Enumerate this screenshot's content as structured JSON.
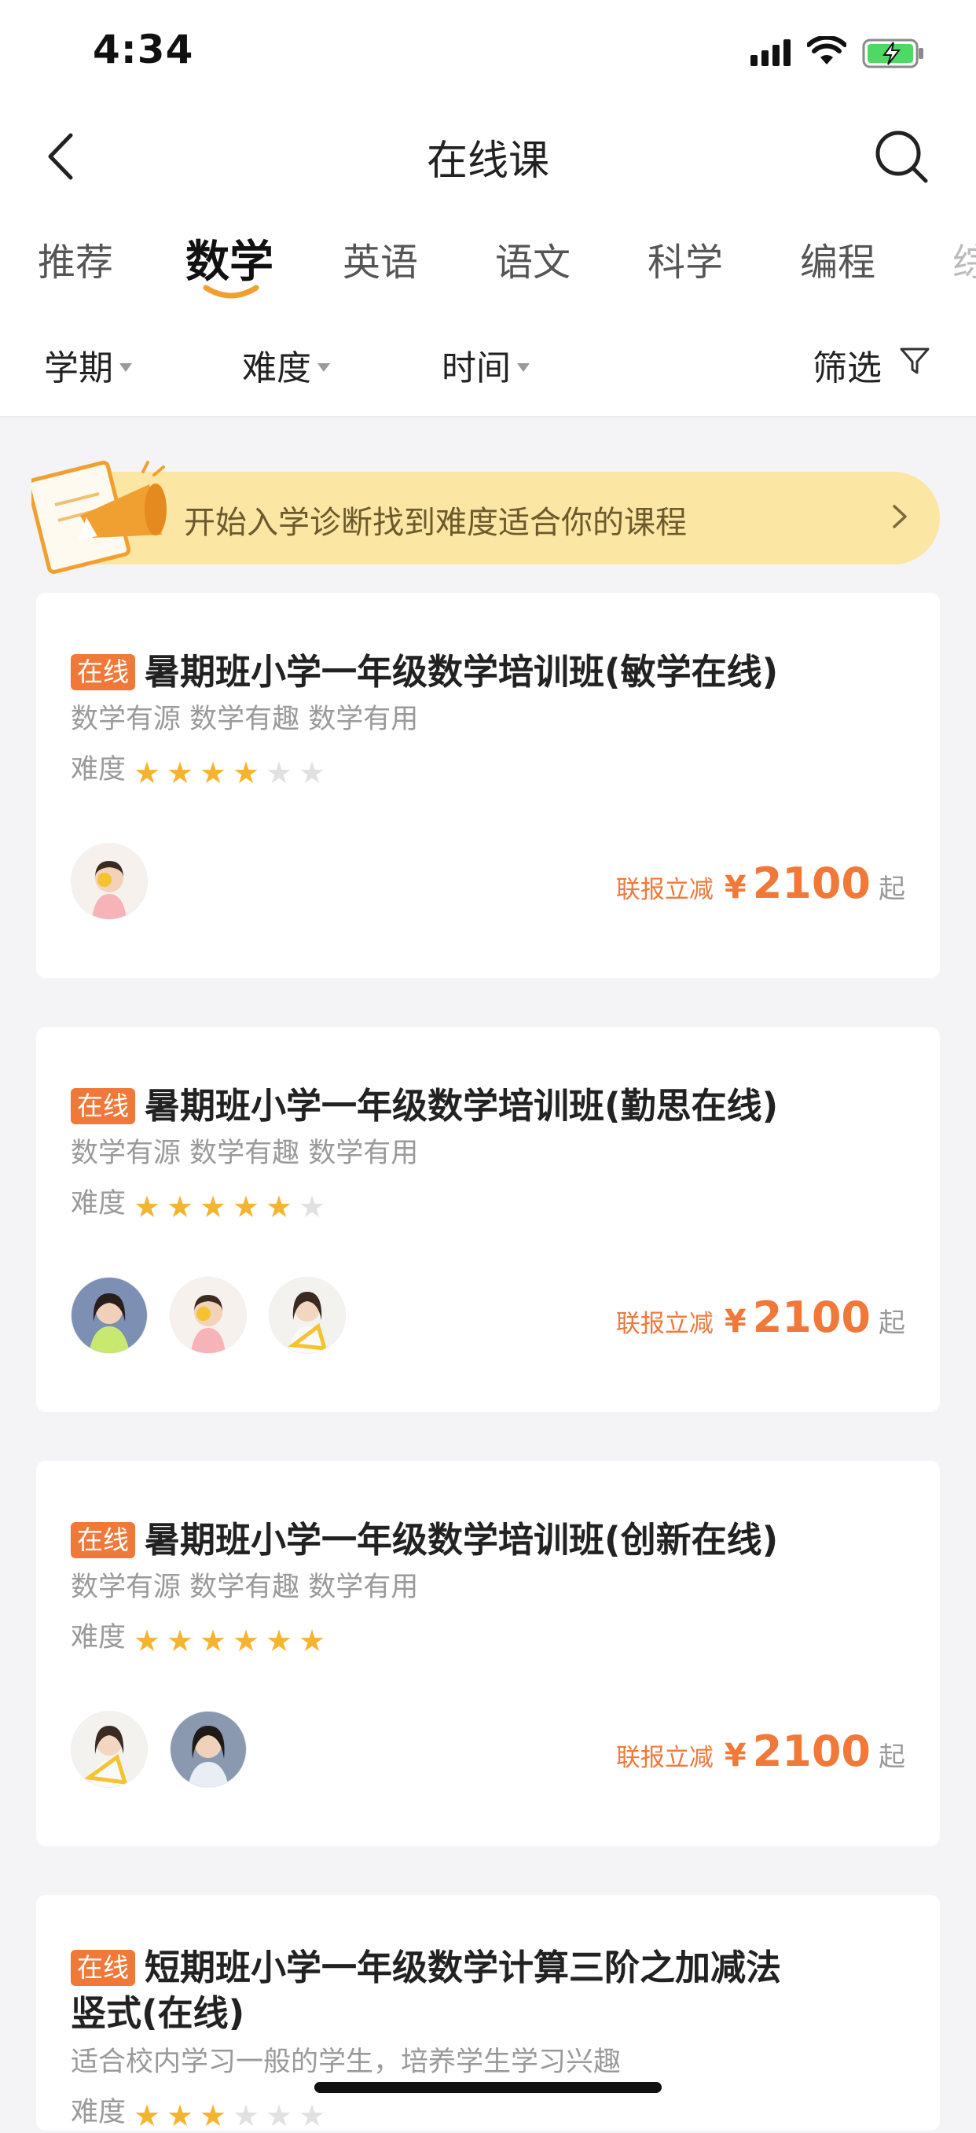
{
  "status": {
    "time": "4:34",
    "signal_icon": "cellular-signal-icon",
    "wifi_icon": "wifi-icon",
    "battery_icon": "battery-charging-icon"
  },
  "nav": {
    "title": "在线课",
    "back_icon": "chevron-left-icon",
    "search_icon": "search-icon"
  },
  "tabs": [
    {
      "label": "推荐"
    },
    {
      "label": "数学",
      "active": true
    },
    {
      "label": "英语"
    },
    {
      "label": "语文"
    },
    {
      "label": "科学"
    },
    {
      "label": "编程"
    },
    {
      "label": "综"
    }
  ],
  "filters": {
    "term": "学期",
    "difficulty": "难度",
    "time": "时间",
    "filter": "筛选",
    "filter_icon": "funnel-icon"
  },
  "banner": {
    "text": "开始入学诊断找到难度适合你的课程",
    "icon": "megaphone-icon",
    "arrow_icon": "chevron-right-icon"
  },
  "courses": [
    {
      "badge": "在线",
      "title": "暑期班小学一年级数学培训班(敏学在线)",
      "subtitle": "数学有源 数学有趣 数学有用",
      "difficulty_label": "难度",
      "stars": 4,
      "max_stars": 6,
      "teachers": 1,
      "promo": "联报立减",
      "currency": "¥",
      "price": "2100",
      "suffix": "起"
    },
    {
      "badge": "在线",
      "title": "暑期班小学一年级数学培训班(勤思在线)",
      "subtitle": "数学有源 数学有趣 数学有用",
      "difficulty_label": "难度",
      "stars": 5,
      "max_stars": 6,
      "teachers": 3,
      "promo": "联报立减",
      "currency": "¥",
      "price": "2100",
      "suffix": "起"
    },
    {
      "badge": "在线",
      "title": "暑期班小学一年级数学培训班(创新在线)",
      "subtitle": "数学有源 数学有趣 数学有用",
      "difficulty_label": "难度",
      "stars": 6,
      "max_stars": 6,
      "teachers": 2,
      "promo": "联报立减",
      "currency": "¥",
      "price": "2100",
      "suffix": "起"
    },
    {
      "badge": "在线",
      "title_line1": "短期班小学一年级数学计算三阶之加减法",
      "title_line2": "竖式(在线)",
      "subtitle": "适合校内学习一般的学生，培养学生学习兴趣",
      "difficulty_label": "难度",
      "stars": 3,
      "max_stars": 6
    }
  ],
  "colors": {
    "accent": "#f0793a",
    "star": "#f5b430",
    "banner": "#fbe6a3"
  }
}
